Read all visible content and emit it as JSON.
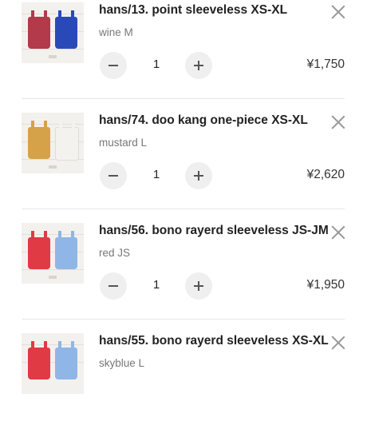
{
  "cart": {
    "items": [
      {
        "title": "hans/13. point sleeveless XS-XL",
        "variant": "wine M",
        "quantity": "1",
        "price": "¥1,750",
        "image_colors": [
          "#b23a4a",
          "#2a49b8"
        ],
        "remove_icon": "close-icon",
        "decrease_icon": "minus-icon",
        "increase_icon": "plus-icon"
      },
      {
        "title": "hans/74. doo kang one-piece XS-XL",
        "variant": "mustard L",
        "quantity": "1",
        "price": "¥2,620",
        "image_colors": [
          "#d5a24a",
          "#f4f2ee"
        ],
        "remove_icon": "close-icon",
        "decrease_icon": "minus-icon",
        "increase_icon": "plus-icon"
      },
      {
        "title": "hans/56. bono rayerd sleeveless JS-JM",
        "variant": "red JS",
        "quantity": "1",
        "price": "¥1,950",
        "image_colors": [
          "#e03a45",
          "#8fb6e6"
        ],
        "remove_icon": "close-icon",
        "decrease_icon": "minus-icon",
        "increase_icon": "plus-icon"
      },
      {
        "title": "hans/55. bono rayerd sleeveless XS-XL",
        "variant": "skyblue L",
        "image_colors": [
          "#e03a45",
          "#8fb6e6"
        ],
        "remove_icon": "close-icon"
      }
    ]
  }
}
